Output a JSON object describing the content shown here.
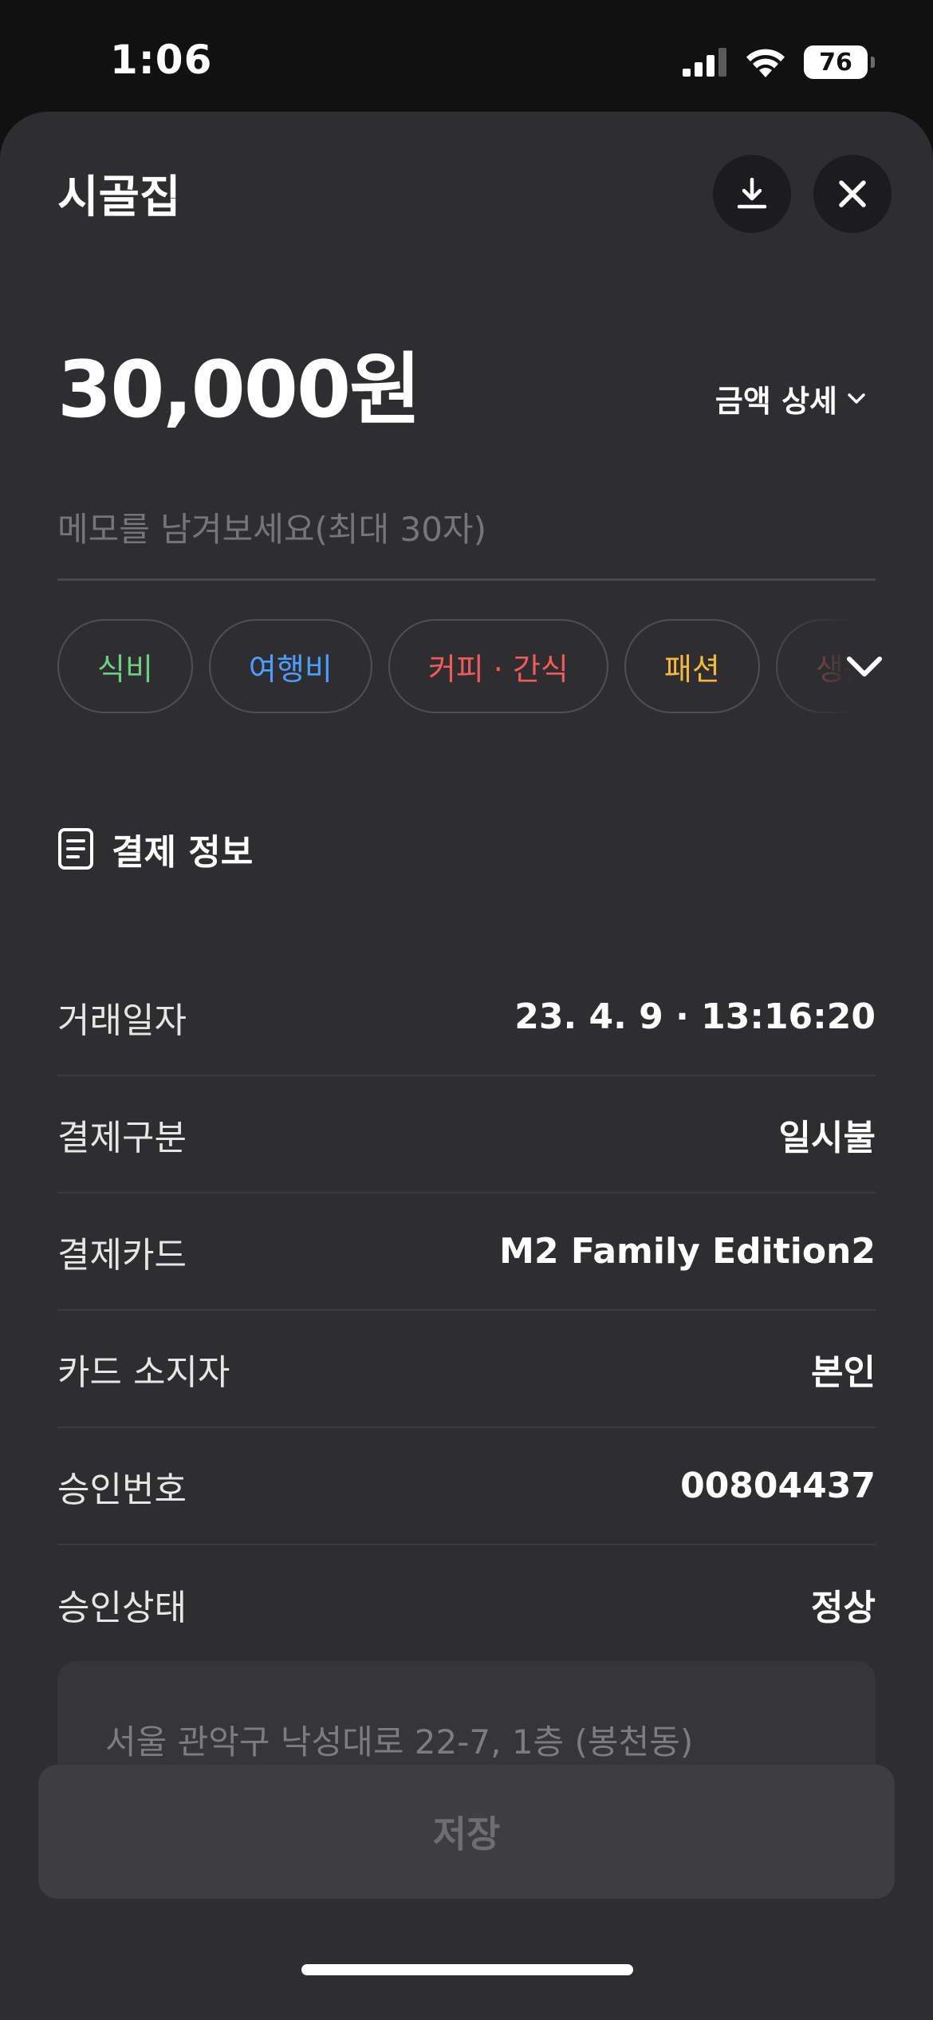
{
  "status_bar": {
    "time": "1:06",
    "battery": "76"
  },
  "header": {
    "merchant_name": "시골집",
    "download_icon": "download-icon",
    "close_icon": "close-icon"
  },
  "amount": {
    "value": "30,000원",
    "detail_label": "금액 상세"
  },
  "memo": {
    "value": "",
    "placeholder": "메모를 남겨보세요(최대 30자)"
  },
  "categories": [
    {
      "label": "식비",
      "color": "#6bcf7f"
    },
    {
      "label": "여행비",
      "color": "#4a9eff"
    },
    {
      "label": "커피 · 간식",
      "color": "#f05a5a"
    },
    {
      "label": "패션",
      "color": "#f5b83d"
    },
    {
      "label": "생활",
      "color": "#c96b6b"
    }
  ],
  "payment_info": {
    "section_title": "결제 정보",
    "rows": [
      {
        "label": "거래일자",
        "value": "23. 4. 9 · 13:16:20"
      },
      {
        "label": "결제구분",
        "value": "일시불"
      },
      {
        "label": "결제카드",
        "value": "M2 Family Edition2"
      },
      {
        "label": "카드 소지자",
        "value": "본인"
      },
      {
        "label": "승인번호",
        "value": "00804437"
      },
      {
        "label": "승인상태",
        "value": "정상"
      }
    ]
  },
  "address": "서울 관악구 낙성대로 22-7, 1층 (봉천동)",
  "save_button": "저장"
}
